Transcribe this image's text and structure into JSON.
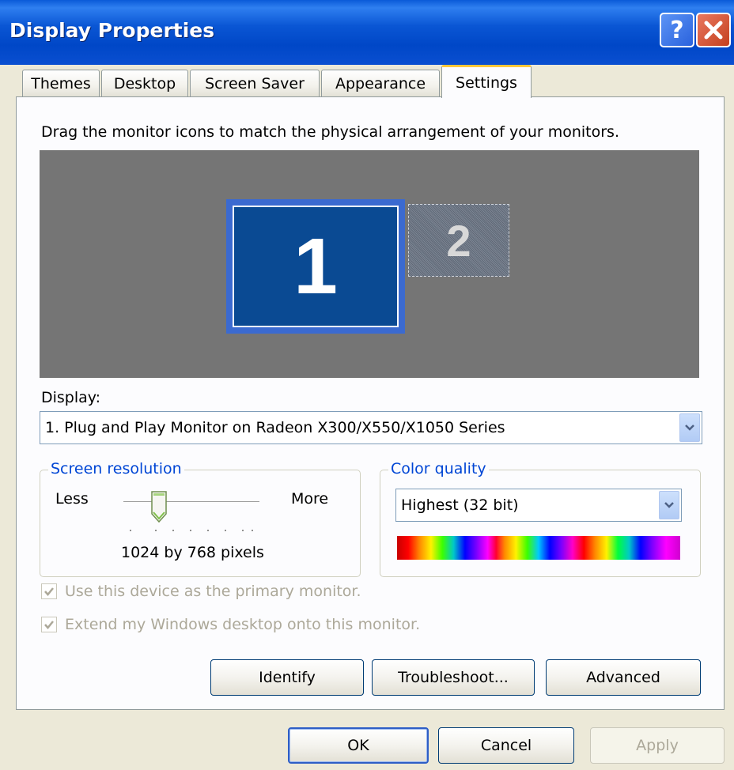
{
  "window": {
    "title": "Display Properties"
  },
  "tabs": [
    {
      "label": "Themes"
    },
    {
      "label": "Desktop"
    },
    {
      "label": "Screen Saver"
    },
    {
      "label": "Appearance"
    },
    {
      "label": "Settings",
      "active": true
    }
  ],
  "settings": {
    "instruction": "Drag the monitor icons to match the physical arrangement of your monitors.",
    "monitors": [
      {
        "number": "1",
        "selected": true
      },
      {
        "number": "2",
        "selected": false
      }
    ],
    "display_label": "Display:",
    "display_value": "1. Plug and Play Monitor on Radeon X300/X550/X1050 Series",
    "screen_resolution": {
      "title": "Screen resolution",
      "less_label": "Less",
      "more_label": "More",
      "value_text": "1024 by 768 pixels",
      "slider_position": 0.28
    },
    "color_quality": {
      "title": "Color quality",
      "value": "Highest (32 bit)"
    },
    "checkboxes": [
      {
        "label": "Use this device as the primary monitor.",
        "checked": true,
        "enabled": false
      },
      {
        "label": "Extend my Windows desktop onto this monitor.",
        "checked": true,
        "enabled": false
      }
    ],
    "buttons": {
      "identify": "Identify",
      "troubleshoot": "Troubleshoot...",
      "advanced": "Advanced"
    }
  },
  "dialog_buttons": {
    "ok": "OK",
    "cancel": "Cancel",
    "apply": "Apply"
  },
  "colors": {
    "titlebar": "#0a56d4",
    "monitor_area": "#757575",
    "monitor_selected": "#0a4a93",
    "group_title": "#0046d5",
    "active_tab_accent": "#ffc73c"
  }
}
